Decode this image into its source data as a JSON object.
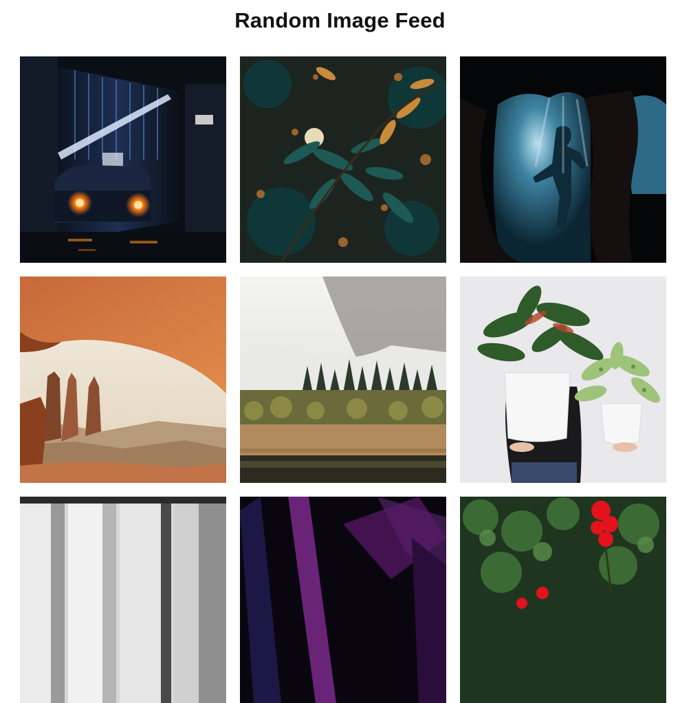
{
  "header": {
    "title": "Random Image Feed"
  },
  "feed": {
    "images": [
      {
        "name": "tunnel-car-photo"
      },
      {
        "name": "leaves-bokeh-photo"
      },
      {
        "name": "underwater-cave-diver-photo"
      },
      {
        "name": "canyon-arch-photo"
      },
      {
        "name": "misty-forest-meadow-photo"
      },
      {
        "name": "potted-plants-photo"
      },
      {
        "name": "white-building-facade-photo"
      },
      {
        "name": "abstract-purple-shapes-photo"
      },
      {
        "name": "red-flowers-bush-photo"
      }
    ]
  },
  "colors": {
    "background": "#ffffff",
    "title": "#111111"
  }
}
